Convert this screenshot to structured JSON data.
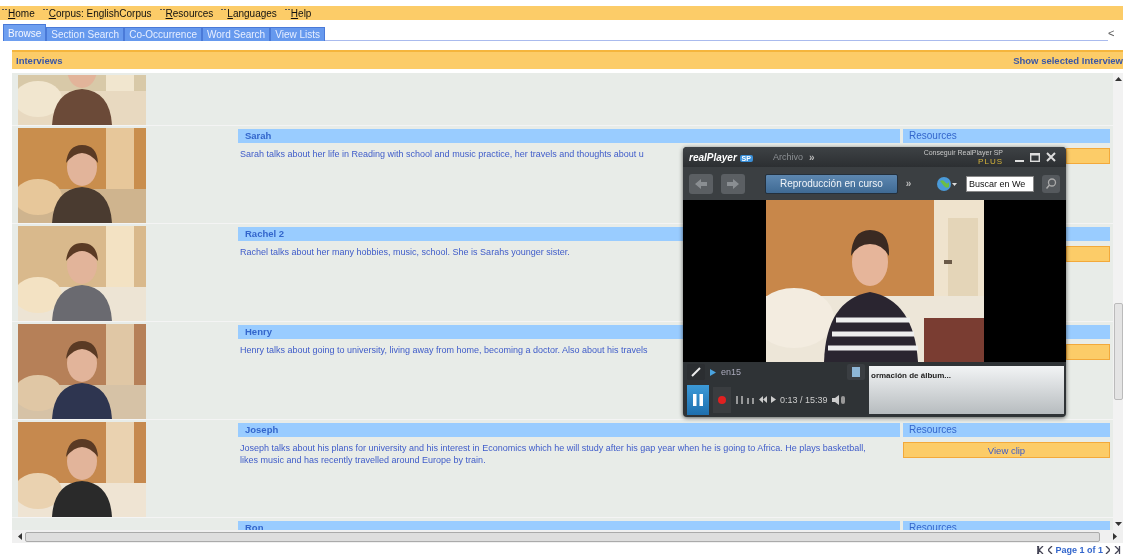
{
  "menu": [
    {
      "label": "Home"
    },
    {
      "label": "Corpus: EnglishCorpus"
    },
    {
      "label": "Resources"
    },
    {
      "label": "Languages"
    },
    {
      "label": "Help"
    }
  ],
  "tabs": [
    {
      "label": "Browse",
      "selected": true
    },
    {
      "label": "Section Search",
      "selected": false
    },
    {
      "label": "Co-Occurrence",
      "selected": false
    },
    {
      "label": "Word Search",
      "selected": false
    },
    {
      "label": "View Lists",
      "selected": false
    }
  ],
  "tab_scroll": "<",
  "panel": {
    "title": "Interviews",
    "action": "Show selected Interview"
  },
  "interviews": [
    {
      "photo": {
        "kind": "picture"
      }
    },
    {
      "photo": {
        "kind": "picture"
      },
      "name": "Sarah",
      "description": "Sarah talks about her life in Reading with school and music practice, her travels and thoughts about u",
      "resources": "Resources",
      "clip_button": true
    },
    {
      "photo": {
        "kind": "picture"
      },
      "name": "Rachel 2",
      "description": "Rachel talks about her many hobbies, music, school. She is Sarahs younger sister.",
      "clip_button": true
    },
    {
      "photo": {
        "kind": "picture"
      },
      "name": "Henry",
      "description": "Henry talks about going to university, living away from home, becoming a doctor. Also about his travels",
      "clip_button": true
    },
    {
      "photo": {
        "kind": "picture"
      },
      "name": "Joseph",
      "description": "Joseph talks about his plans for university and his interest in Economics which he will study after his gap year when he is going to Africa. He plays basketball, likes music and has recently travelled around Europe by train.",
      "resources": "Resources",
      "clip_button": true,
      "view_clip": "View clip"
    },
    {
      "name": "Ron",
      "resources": "Resources"
    }
  ],
  "pager": {
    "text": "Page 1 of 1"
  },
  "player": {
    "logo": "realPlayer",
    "logo_badge": "SP",
    "menu": "Archivo",
    "menu_more": "»",
    "promo": "Conseguir RealPlayer SP",
    "promo_badge": "PLUS",
    "now_playing_tab": "Reproducción en curso",
    "more": "»",
    "search": {
      "value": "Buscar en We"
    },
    "video": {
      "kind": "picture"
    },
    "track": "en15",
    "info": "ormación de álbum...",
    "time": "0:13 / 15:39",
    "playing": true
  }
}
